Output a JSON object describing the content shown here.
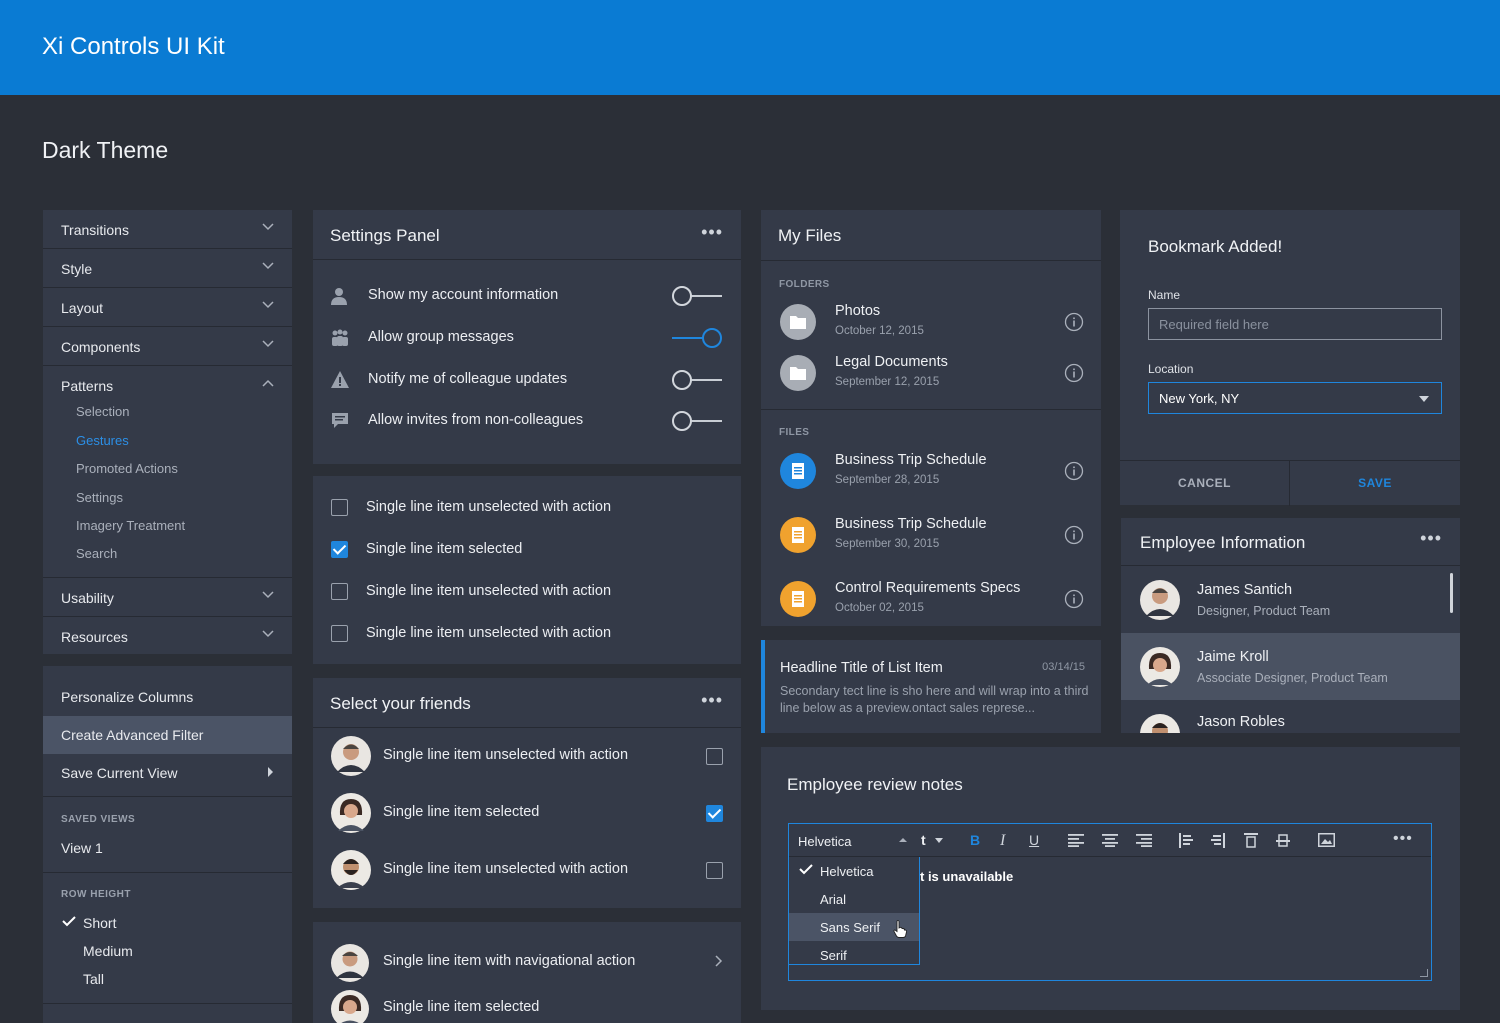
{
  "header": {
    "title": "Xi Controls UI Kit"
  },
  "page": {
    "subtitle": "Dark Theme"
  },
  "nav": {
    "items": [
      {
        "label": "Transitions"
      },
      {
        "label": "Style"
      },
      {
        "label": "Layout"
      },
      {
        "label": "Components"
      },
      {
        "label": "Patterns"
      }
    ],
    "patterns_sub": [
      "Selection",
      "Gestures",
      "Promoted Actions",
      "Settings",
      "Imagery Treatment",
      "Search"
    ],
    "after": [
      {
        "label": "Usability"
      },
      {
        "label": "Resources"
      }
    ]
  },
  "menu": {
    "personalize": "Personalize Columns",
    "advanced_filter": "Create Advanced Filter",
    "save_view": "Save Current View",
    "saved_views_header": "SAVED VIEWS",
    "view1": "View 1",
    "row_height_header": "ROW HEIGHT",
    "short": "Short",
    "medium": "Medium",
    "tall": "Tall"
  },
  "settings": {
    "title": "Settings Panel",
    "more": "•••",
    "rows": [
      {
        "label": "Show my account information",
        "on": false
      },
      {
        "label": "Allow group messages",
        "on": true
      },
      {
        "label": "Notify me of colleague updates",
        "on": false
      },
      {
        "label": "Allow invites from non-colleagues",
        "on": false
      }
    ]
  },
  "checklist": {
    "rows": [
      {
        "label": "Single line item unselected with action",
        "checked": false
      },
      {
        "label": "Single line item selected",
        "checked": true
      },
      {
        "label": "Single line item unselected with action",
        "checked": false
      },
      {
        "label": "Single line item unselected with action",
        "checked": false
      }
    ]
  },
  "friends": {
    "title": "Select your friends",
    "more": "•••",
    "rows": [
      {
        "label": "Single line item unselected with action",
        "checked": false
      },
      {
        "label": "Single line item selected",
        "checked": true
      },
      {
        "label": "Single line item unselected with action",
        "checked": false
      }
    ]
  },
  "navlist": {
    "rows": [
      {
        "label": "Single line item with navigational action"
      },
      {
        "label": "Single line item selected"
      }
    ]
  },
  "files": {
    "title": "My Files",
    "folders_header": "FOLDERS",
    "files_header": "FILES",
    "folders": [
      {
        "name": "Photos",
        "date": "October 12, 2015"
      },
      {
        "name": "Legal Documents",
        "date": "September 12, 2015"
      }
    ],
    "files": [
      {
        "name": "Business Trip Schedule",
        "date": "September 28, 2015",
        "color": "#1f86dd"
      },
      {
        "name": "Business Trip Schedule",
        "date": "September 30, 2015",
        "color": "#f0a22e"
      },
      {
        "name": "Control Requirements Specs",
        "date": "October 02, 2015",
        "color": "#f0a22e"
      }
    ]
  },
  "headline": {
    "title": "Headline Title of List Item",
    "date": "03/14/15",
    "secondary": "Secondary tect line is sho here and will wrap into a third line below as a preview.ontact sales represe..."
  },
  "bookmark": {
    "title": "Bookmark Added!",
    "name_label": "Name",
    "name_placeholder": "Required field here",
    "location_label": "Location",
    "location_value": "New York, NY",
    "cancel": "CANCEL",
    "save": "SAVE"
  },
  "employee": {
    "title": "Employee Information",
    "more": "•••",
    "rows": [
      {
        "name": "James Santich",
        "role": "Designer, Product Team"
      },
      {
        "name": "Jaime Kroll",
        "role": "Associate Designer, Product Team"
      },
      {
        "name": "Jason Robles",
        "role": ""
      }
    ]
  },
  "review": {
    "title": "Employee review notes",
    "font_value": "Helvetica",
    "size_fragment": "t",
    "content_fragment": "t is unavailable",
    "fonts": [
      "Helvetica",
      "Arial",
      "Sans Serif",
      "Serif"
    ],
    "toolbar": {
      "bold": "B",
      "italic": "I",
      "underline": "U",
      "more": "•••"
    }
  },
  "colors": {
    "accent": "#1f86dd",
    "header": "#0a7bd3",
    "background": "#2b2f37",
    "panel": "#343a48",
    "file_orange": "#f0a22e"
  }
}
